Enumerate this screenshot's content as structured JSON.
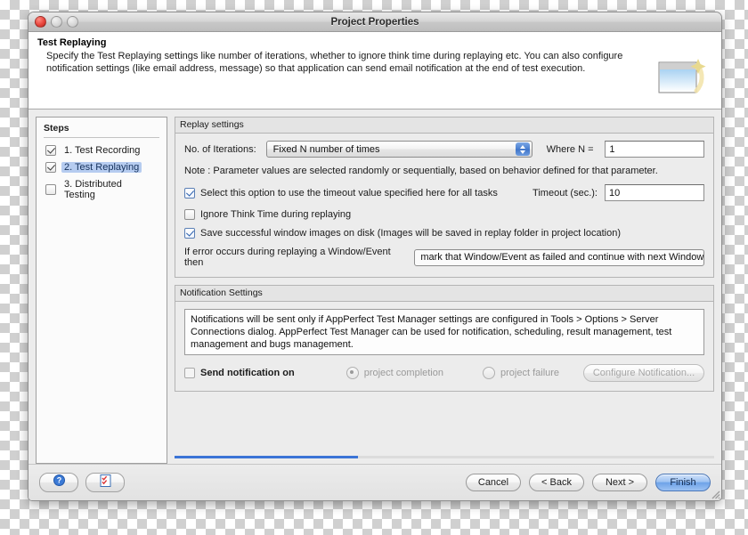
{
  "window": {
    "title": "Project Properties",
    "controls": {
      "close": "close-button",
      "minimize": "minimize-button",
      "maximize": "maximize-button"
    }
  },
  "banner": {
    "title": "Test Replaying",
    "description": "Specify the Test Replaying settings like number of iterations, whether to ignore think time during replaying etc. You can also configure notification settings (like email address, message) so that application can send email notification at the end of test execution.",
    "icon": "wizard-window-sparkle-icon"
  },
  "steps": {
    "header": "Steps",
    "items": [
      {
        "label": "1. Test Recording",
        "checked": true,
        "selected": false
      },
      {
        "label": "2. Test Replaying",
        "checked": true,
        "selected": true
      },
      {
        "label": "3. Distributed Testing",
        "checked": false,
        "selected": false
      }
    ]
  },
  "replay": {
    "group_title": "Replay settings",
    "iterations_label": "No. of Iterations:",
    "iterations_value": "Fixed N number of times",
    "where_n_label": "Where N =",
    "where_n_value": "1",
    "note": "Note : Parameter values are selected randomly or sequentially, based on behavior defined for that parameter.",
    "timeout_option_label": "Select this option to use the timeout value specified here for all tasks",
    "timeout_option_checked": true,
    "timeout_label": "Timeout (sec.):",
    "timeout_value": "10",
    "ignore_think_time_label": "Ignore Think Time during replaying",
    "ignore_think_time_checked": false,
    "save_images_label": "Save successful window images on disk (Images will be saved in replay folder in project location)",
    "save_images_checked": true,
    "on_error_label": "If error occurs during replaying a Window/Event then",
    "on_error_value": "mark that Window/Event as failed and continue with next Window/"
  },
  "notification": {
    "group_title": "Notification Settings",
    "info": "Notifications will be sent only if AppPerfect Test Manager settings are configured in Tools > Options > Server Connections dialog. AppPerfect Test Manager can be used for notification, scheduling, result management, test management and bugs management.",
    "send_label": "Send notification on",
    "send_checked": false,
    "option_completion": "project completion",
    "option_failure": "project failure",
    "selected_option": "project completion",
    "configure_button": "Configure Notification..."
  },
  "footer": {
    "help_icon": "help-question-icon",
    "checklist_icon": "checklist-icon",
    "cancel": "Cancel",
    "back": "< Back",
    "next": "Next >",
    "finish": "Finish",
    "resize_grip": "resize-grip-icon"
  },
  "colors": {
    "accent": "#3b74d6",
    "selection": "#b6ccf0",
    "default_button": "#6ea3e8"
  }
}
